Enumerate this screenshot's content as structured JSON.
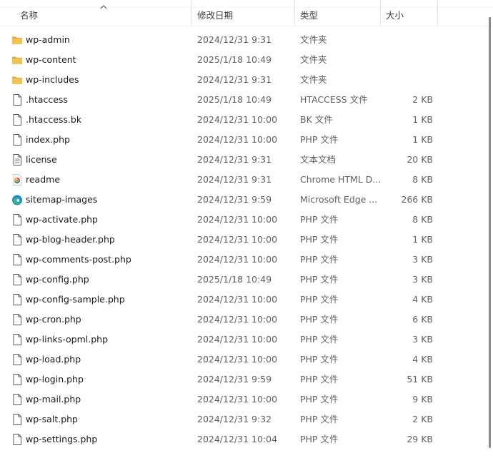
{
  "columns": {
    "name": "名称",
    "date": "修改日期",
    "type": "类型",
    "size": "大小"
  },
  "files": [
    {
      "icon": "folder-icon",
      "name": "wp-admin",
      "date": "2024/12/31 9:31",
      "type": "文件夹",
      "size": ""
    },
    {
      "icon": "folder-icon",
      "name": "wp-content",
      "date": "2025/1/18 10:49",
      "type": "文件夹",
      "size": ""
    },
    {
      "icon": "folder-icon",
      "name": "wp-includes",
      "date": "2024/12/31 9:31",
      "type": "文件夹",
      "size": ""
    },
    {
      "icon": "file-icon",
      "name": ".htaccess",
      "date": "2025/1/18 10:49",
      "type": "HTACCESS 文件",
      "size": "2 KB"
    },
    {
      "icon": "file-icon",
      "name": ".htaccess.bk",
      "date": "2024/12/31 10:00",
      "type": "BK 文件",
      "size": "1 KB"
    },
    {
      "icon": "file-icon",
      "name": "index.php",
      "date": "2024/12/31 10:00",
      "type": "PHP 文件",
      "size": "1 KB"
    },
    {
      "icon": "text-document-icon",
      "name": "license",
      "date": "2024/12/31 9:31",
      "type": "文本文档",
      "size": "20 KB"
    },
    {
      "icon": "chrome-icon",
      "name": "readme",
      "date": "2024/12/31 9:31",
      "type": "Chrome HTML D...",
      "size": "8 KB"
    },
    {
      "icon": "edge-icon",
      "name": "sitemap-images",
      "date": "2024/12/31 9:59",
      "type": "Microsoft Edge ...",
      "size": "266 KB"
    },
    {
      "icon": "file-icon",
      "name": "wp-activate.php",
      "date": "2024/12/31 10:00",
      "type": "PHP 文件",
      "size": "8 KB"
    },
    {
      "icon": "file-icon",
      "name": "wp-blog-header.php",
      "date": "2024/12/31 10:00",
      "type": "PHP 文件",
      "size": "1 KB"
    },
    {
      "icon": "file-icon",
      "name": "wp-comments-post.php",
      "date": "2024/12/31 10:00",
      "type": "PHP 文件",
      "size": "3 KB"
    },
    {
      "icon": "file-icon",
      "name": "wp-config.php",
      "date": "2025/1/18 10:49",
      "type": "PHP 文件",
      "size": "3 KB"
    },
    {
      "icon": "file-icon",
      "name": "wp-config-sample.php",
      "date": "2024/12/31 10:00",
      "type": "PHP 文件",
      "size": "4 KB"
    },
    {
      "icon": "file-icon",
      "name": "wp-cron.php",
      "date": "2024/12/31 10:00",
      "type": "PHP 文件",
      "size": "6 KB"
    },
    {
      "icon": "file-icon",
      "name": "wp-links-opml.php",
      "date": "2024/12/31 10:00",
      "type": "PHP 文件",
      "size": "3 KB"
    },
    {
      "icon": "file-icon",
      "name": "wp-load.php",
      "date": "2024/12/31 10:00",
      "type": "PHP 文件",
      "size": "4 KB"
    },
    {
      "icon": "file-icon",
      "name": "wp-login.php",
      "date": "2024/12/31 9:59",
      "type": "PHP 文件",
      "size": "51 KB"
    },
    {
      "icon": "file-icon",
      "name": "wp-mail.php",
      "date": "2024/12/31 10:00",
      "type": "PHP 文件",
      "size": "9 KB"
    },
    {
      "icon": "file-icon",
      "name": "wp-salt.php",
      "date": "2024/12/31 9:32",
      "type": "PHP 文件",
      "size": "2 KB"
    },
    {
      "icon": "file-icon",
      "name": "wp-settings.php",
      "date": "2024/12/31 10:04",
      "type": "PHP 文件",
      "size": "29 KB"
    }
  ],
  "colors": {
    "folder": "#f4c44e",
    "folder_dark": "#e2a93a",
    "file_outline": "#5a5a5a",
    "edge": "#1b8bd8"
  }
}
